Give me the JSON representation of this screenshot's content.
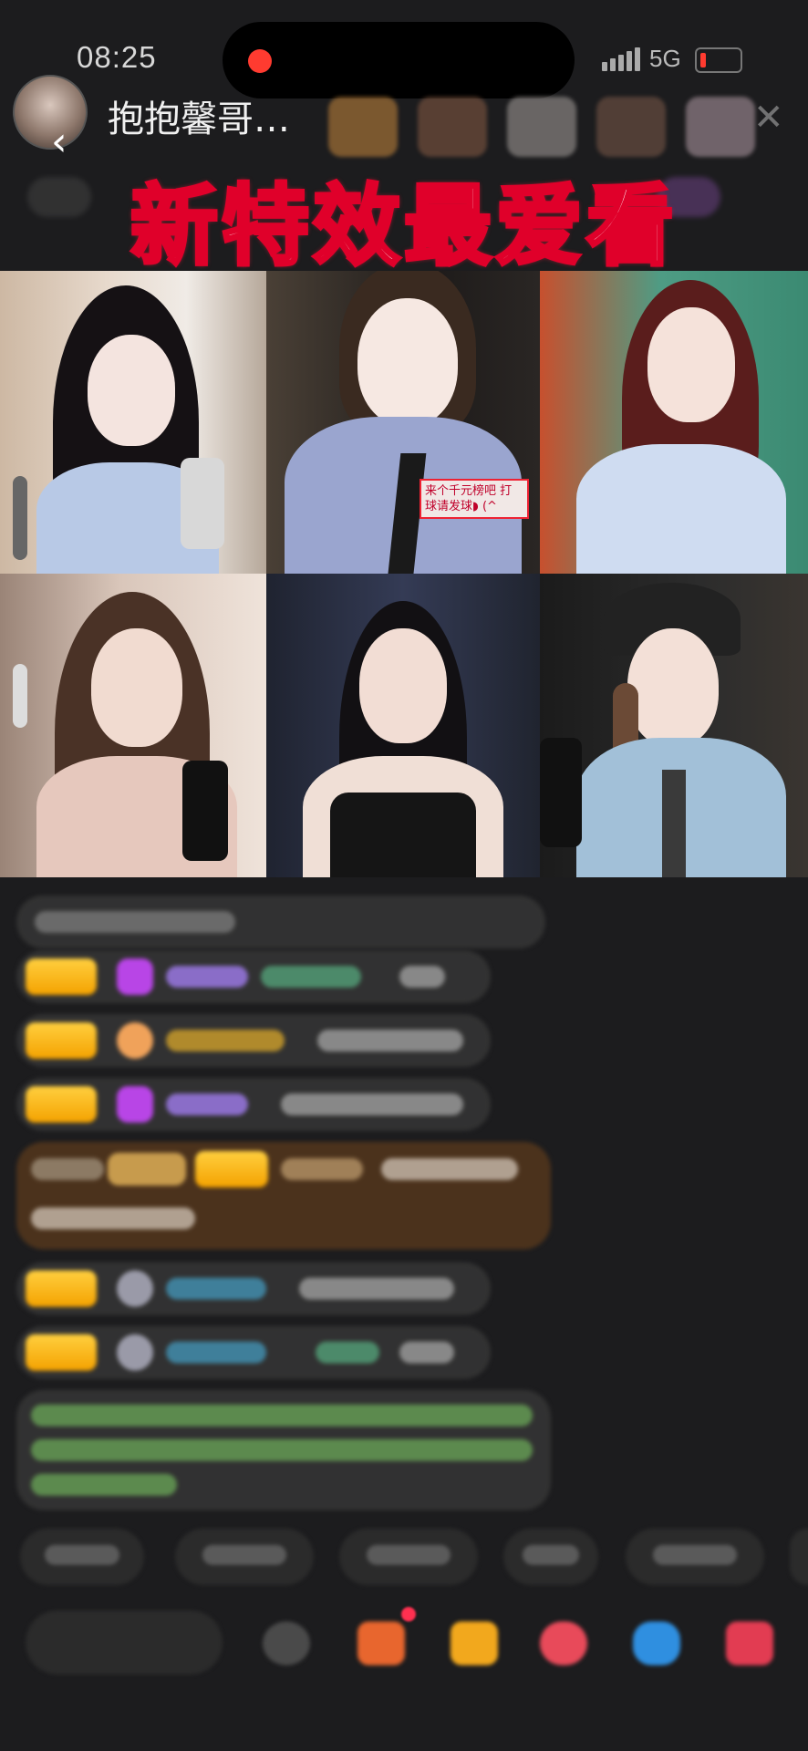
{
  "status_bar": {
    "time": "08:25",
    "network": "5G"
  },
  "header": {
    "streamer_name": "抱抱馨哥…",
    "back_label": "‹",
    "close_label": "✕"
  },
  "overlay": {
    "headline": "新特效最爱看"
  },
  "grid": {
    "tiles": [
      {
        "skin": "#f3e2dc",
        "hair": "#161214",
        "cloth": "#b9c8e4",
        "bg": "#d8c5b4"
      },
      {
        "skin": "#f4e4de",
        "hair": "#3b2a20",
        "cloth": "#9aa6cf",
        "bg": "#2a2624"
      },
      {
        "skin": "#f5e1d8",
        "hair": "#5a1f1e",
        "cloth": "#c9d7ef",
        "bg": "#3f8f79"
      },
      {
        "skin": "#f1d9ce",
        "hair": "#4a3227",
        "cloth": "#e7c7bb",
        "bg": "#c7b0a2"
      },
      {
        "skin": "#f2dcd3",
        "hair": "#121013",
        "cloth": "#1b1b1b",
        "bg": "#2d3348"
      },
      {
        "skin": "#f3e0d7",
        "hair": "#5b4030",
        "cloth": "#9fbfd8",
        "bg": "#2a2a2a"
      }
    ],
    "sign_text": "来个千元榜吧 打球请发球◗ (^"
  },
  "colors": {
    "accent_red": "#e0002a",
    "gold": "#f4a200",
    "chat_bg": "#1c1c1e"
  }
}
